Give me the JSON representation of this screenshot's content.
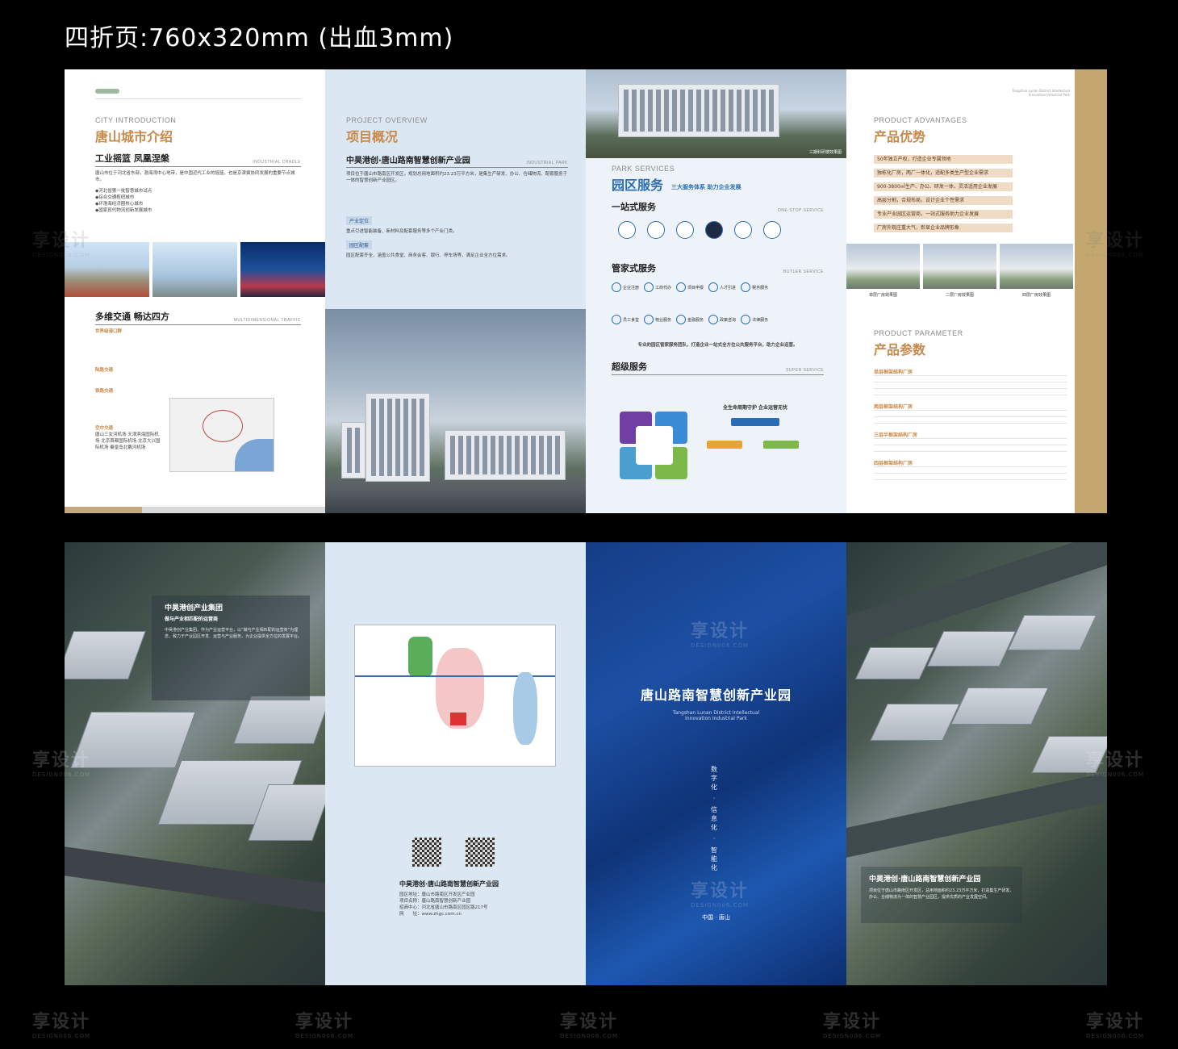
{
  "header": {
    "title": "四折页:760x320mm (出血3mm)"
  },
  "watermark": {
    "text": "享设计",
    "sub": "DESIGN006.COM"
  },
  "panel1": {
    "en": "CITY INTRODUCTION",
    "cn": "唐山城市介绍",
    "sub1": "工业摇篮  凤凰涅槃",
    "sub1_en": "INDUSTRIAL CRADLE",
    "body1": "唐山市位于河北省东部，渤海湾中心地带，是中国近代工业的摇篮，也是京津冀协同发展的重要节点城市。",
    "bullets": [
      "◆河北省第一批智慧城市试点",
      "◆综合交通枢纽城市",
      "◆环渤海经济圈核心城市",
      "◆国家现代物流创新发展城市"
    ],
    "sub2": "多维交通  畅达四方",
    "sub2_en": "MULTIDIMENSIONAL TRAFFIC",
    "traffic_h1": "世界级港口群",
    "traffic_h2": "陆路交通",
    "traffic_h3": "铁路交通",
    "traffic_h4": "空中交通",
    "air_text": "唐山三女河机场 天津滨海国际机场 北京首都国际机场 北京大兴国际机场 秦皇岛北戴河机场"
  },
  "panel2": {
    "en": "PROJECT OVERVIEW",
    "cn": "项目概况",
    "sub": "中昊港创·唐山路南智慧创新产业园",
    "sub_en": "INDUSTRIAL PARK",
    "body": "项目位于唐山市路南区开发区，规划总用地面积约23.23万平方米，是集生产研发、办公、仓储物流、配套服务于一体的智慧创新产业园区。",
    "tag1": "产业定位",
    "body2": "重点引进智能装备、新材料及配套服务等多个产业门类。",
    "tag2": "园区配套",
    "body3": "园区配套齐全，涵盖公共食堂、商务会客、银行、停车场等，满足企业全方位需求。"
  },
  "panel3": {
    "photo_caption": "三期科研楼效果图",
    "en": "PARK SERVICES",
    "cn": "园区服务",
    "tagline": "三大服务体系 助力企业发展",
    "s1": "一站式服务",
    "s1_en": "ONE-STOP SERVICE",
    "s2": "管家式服务",
    "s2_en": "BUTLER SERVICE",
    "pills": [
      "企业注册",
      "工商代办",
      "项目申报",
      "人才引进",
      "税务服务",
      "员工食堂",
      "物业服务",
      "金融服务",
      "政策咨询",
      "法律服务"
    ],
    "s2_note": "专业的园区管家服务团队，打造企业一站式全方位公共服务平台，助力企业运营。",
    "s3": "超级服务",
    "s3_en": "SUPER SERVICE",
    "flow_title": "全生命周期守护 企业运营无忧"
  },
  "panel4": {
    "en": "PRODUCT ADVANTAGES",
    "cn": "产品优势",
    "advantages": [
      "50年独立产权，打造企业专属领地",
      "独栋化厂房，两厂一体化，适配多类生产型企业需求",
      "900-3800㎡生产、办公、研发一体，灵活适用企业发展",
      "高层分割，合规布局，设计企业个性需求",
      "专业产业园区运营商，一站式服务助力企业发展",
      "厂房外观庄重大气，彰显企业品牌形象"
    ],
    "captions": [
      "单层厂房效果图",
      "二层厂房效果图",
      "四层厂房效果图"
    ],
    "param_en": "PRODUCT PARAMETER",
    "param_cn": "产品参数",
    "params": [
      "单层框架结构厂房",
      "两层框架结构厂房",
      "三层半框架结构厂房",
      "四层框架结构厂房"
    ],
    "corner": "Tangshan Lunan District Intellectual Innovation Industrial Park"
  },
  "panel5": {
    "title": "中昊港创产业集团",
    "sub": "做与产业相匹配的运营商",
    "body": "中昊港创产业集团，作为产业运营平台，以“做与产业相匹配的运营商”为理念，致力于产业园区开发、运营与产业服务，为企业提供全方位的发展平台。"
  },
  "panel6": {
    "title": "中昊港创·唐山路南智慧创新产业园",
    "lines": [
      "园区地址：唐山市路南区开发区产业园",
      "项目名称：唐山路南智慧创新产业园",
      "招商中心：河北省唐山市路南区园区路217号",
      "网　　址：www.zhgc.com.cn"
    ]
  },
  "panel7": {
    "title": "唐山路南智慧创新产业园",
    "en1": "Tangshan Lunan District Intellectual",
    "en2": "Innovation Industrial Park",
    "vertical": [
      "数字化",
      "信息化",
      "智能化"
    ],
    "place": "中国 · 唐山"
  },
  "panel8": {
    "title": "中昊港创·唐山路南智慧创新产业园",
    "body": "项目位于唐山市路南区开发区，总用地面积约23.23万平方米，打造集生产研发、办公、仓储物流为一体的智慧产业园区，提供优质的产业发展空间。"
  }
}
